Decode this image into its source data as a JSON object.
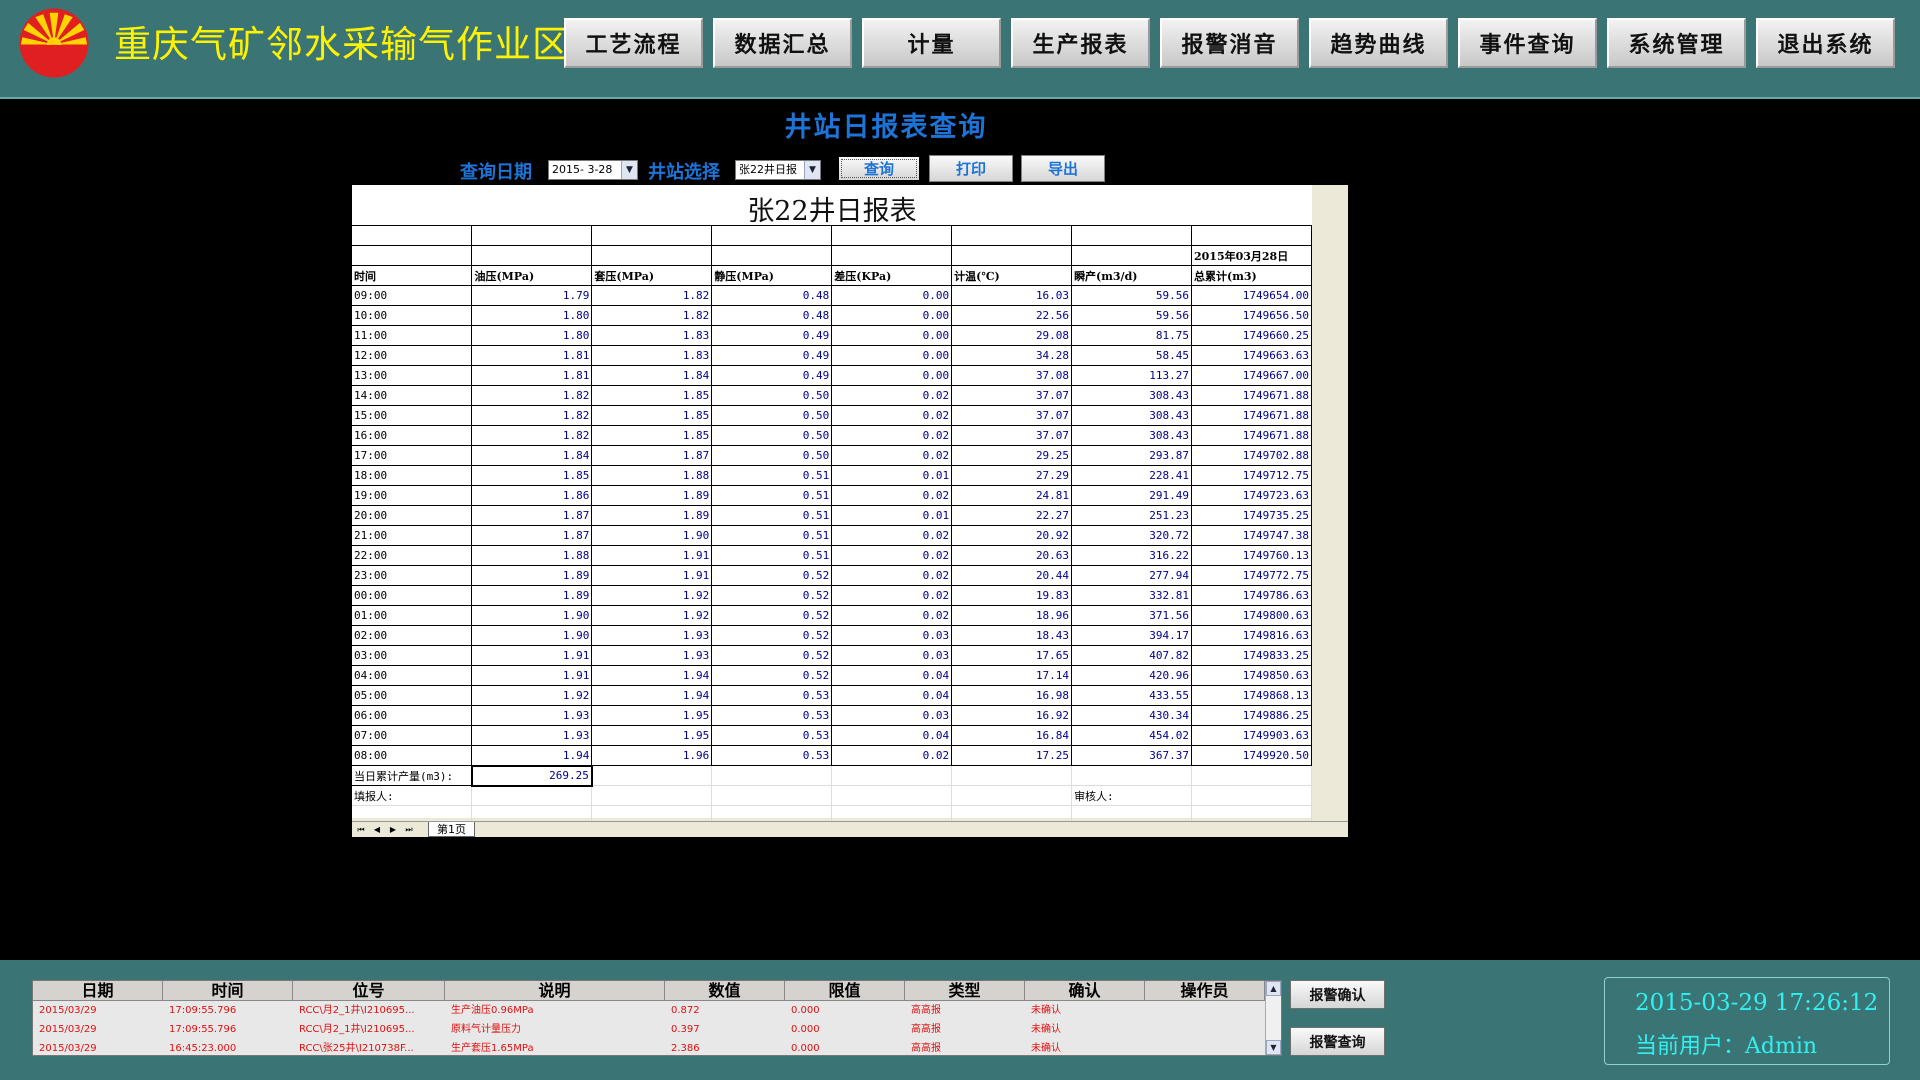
{
  "header": {
    "app_title": "重庆气矿邻水采输气作业区",
    "nav": [
      "工艺流程",
      "数据汇总",
      "计量",
      "生产报表",
      "报警消音",
      "趋势曲线",
      "事件查询",
      "系统管理",
      "退出系统"
    ]
  },
  "query": {
    "page_title": "井站日报表查询",
    "date_label": "查询日期",
    "date_value": "2015- 3-28",
    "station_label": "井站选择",
    "station_value": "张22井日报",
    "buttons": {
      "query": "查询",
      "print": "打印",
      "export": "导出"
    }
  },
  "report": {
    "title": "张22井日报表",
    "date": "2015年03月28日",
    "columns": [
      "时间",
      "油压(MPa)",
      "套压(MPa)",
      "静压(MPa)",
      "差压(KPa)",
      "计温(℃)",
      "瞬产(m3/d)",
      "总累计(m3)"
    ],
    "rows": [
      [
        "09:00",
        "1.79",
        "1.82",
        "0.48",
        "0.00",
        "16.03",
        "59.56",
        "1749654.00"
      ],
      [
        "10:00",
        "1.80",
        "1.82",
        "0.48",
        "0.00",
        "22.56",
        "59.56",
        "1749656.50"
      ],
      [
        "11:00",
        "1.80",
        "1.83",
        "0.49",
        "0.00",
        "29.08",
        "81.75",
        "1749660.25"
      ],
      [
        "12:00",
        "1.81",
        "1.83",
        "0.49",
        "0.00",
        "34.28",
        "58.45",
        "1749663.63"
      ],
      [
        "13:00",
        "1.81",
        "1.84",
        "0.49",
        "0.00",
        "37.08",
        "113.27",
        "1749667.00"
      ],
      [
        "14:00",
        "1.82",
        "1.85",
        "0.50",
        "0.02",
        "37.07",
        "308.43",
        "1749671.88"
      ],
      [
        "15:00",
        "1.82",
        "1.85",
        "0.50",
        "0.02",
        "37.07",
        "308.43",
        "1749671.88"
      ],
      [
        "16:00",
        "1.82",
        "1.85",
        "0.50",
        "0.02",
        "37.07",
        "308.43",
        "1749671.88"
      ],
      [
        "17:00",
        "1.84",
        "1.87",
        "0.50",
        "0.02",
        "29.25",
        "293.87",
        "1749702.88"
      ],
      [
        "18:00",
        "1.85",
        "1.88",
        "0.51",
        "0.01",
        "27.29",
        "228.41",
        "1749712.75"
      ],
      [
        "19:00",
        "1.86",
        "1.89",
        "0.51",
        "0.02",
        "24.81",
        "291.49",
        "1749723.63"
      ],
      [
        "20:00",
        "1.87",
        "1.89",
        "0.51",
        "0.01",
        "22.27",
        "251.23",
        "1749735.25"
      ],
      [
        "21:00",
        "1.87",
        "1.90",
        "0.51",
        "0.02",
        "20.92",
        "320.72",
        "1749747.38"
      ],
      [
        "22:00",
        "1.88",
        "1.91",
        "0.51",
        "0.02",
        "20.63",
        "316.22",
        "1749760.13"
      ],
      [
        "23:00",
        "1.89",
        "1.91",
        "0.52",
        "0.02",
        "20.44",
        "277.94",
        "1749772.75"
      ],
      [
        "00:00",
        "1.89",
        "1.92",
        "0.52",
        "0.02",
        "19.83",
        "332.81",
        "1749786.63"
      ],
      [
        "01:00",
        "1.90",
        "1.92",
        "0.52",
        "0.02",
        "18.96",
        "371.56",
        "1749800.63"
      ],
      [
        "02:00",
        "1.90",
        "1.93",
        "0.52",
        "0.03",
        "18.43",
        "394.17",
        "1749816.63"
      ],
      [
        "03:00",
        "1.91",
        "1.93",
        "0.52",
        "0.03",
        "17.65",
        "407.82",
        "1749833.25"
      ],
      [
        "04:00",
        "1.91",
        "1.94",
        "0.52",
        "0.04",
        "17.14",
        "420.96",
        "1749850.63"
      ],
      [
        "05:00",
        "1.92",
        "1.94",
        "0.53",
        "0.04",
        "16.98",
        "433.55",
        "1749868.13"
      ],
      [
        "06:00",
        "1.93",
        "1.95",
        "0.53",
        "0.03",
        "16.92",
        "430.34",
        "1749886.25"
      ],
      [
        "07:00",
        "1.93",
        "1.95",
        "0.53",
        "0.04",
        "16.84",
        "454.02",
        "1749903.63"
      ],
      [
        "08:00",
        "1.94",
        "1.96",
        "0.53",
        "0.02",
        "17.25",
        "367.37",
        "1749920.50"
      ]
    ],
    "daily_total_label": "当日累计产量(m3):",
    "daily_total_value": "269.25",
    "filler_label": "填报人:",
    "reviewer_label": "审核人:",
    "sheet_tab": "第1页"
  },
  "alarms": {
    "columns": [
      "日期",
      "时间",
      "位号",
      "说明",
      "数值",
      "限值",
      "类型",
      "确认",
      "操作员"
    ],
    "rows": [
      [
        "2015/03/29",
        "17:09:55.796",
        "RCC\\月2_1井\\I210695...",
        "生产油压0.96MPa",
        "0.872",
        "0.000",
        "高高报",
        "未确认",
        ""
      ],
      [
        "2015/03/29",
        "17:09:55.796",
        "RCC\\月2_1井\\I210695...",
        "原料气计量压力",
        "0.397",
        "0.000",
        "高高报",
        "未确认",
        ""
      ],
      [
        "2015/03/29",
        "16:45:23.000",
        "RCC\\张25井\\I210738F...",
        "生产套压1.65MPa",
        "2.386",
        "0.000",
        "高高报",
        "未确认",
        ""
      ]
    ],
    "confirm_button": "报警确认",
    "query_button": "报警查询"
  },
  "status": {
    "datetime": "2015-03-29 17:26:12",
    "user_label": "当前用户：Admin"
  },
  "colors": {
    "header_bg": "#3a7474",
    "title_yellow": "#fdf200",
    "accent_blue": "#1e74d6",
    "value_blue": "#00008b",
    "alarm_red": "#e01010",
    "clock_cyan": "#33f0f0"
  },
  "icons": {
    "logo": "petrochina-logo-icon"
  }
}
